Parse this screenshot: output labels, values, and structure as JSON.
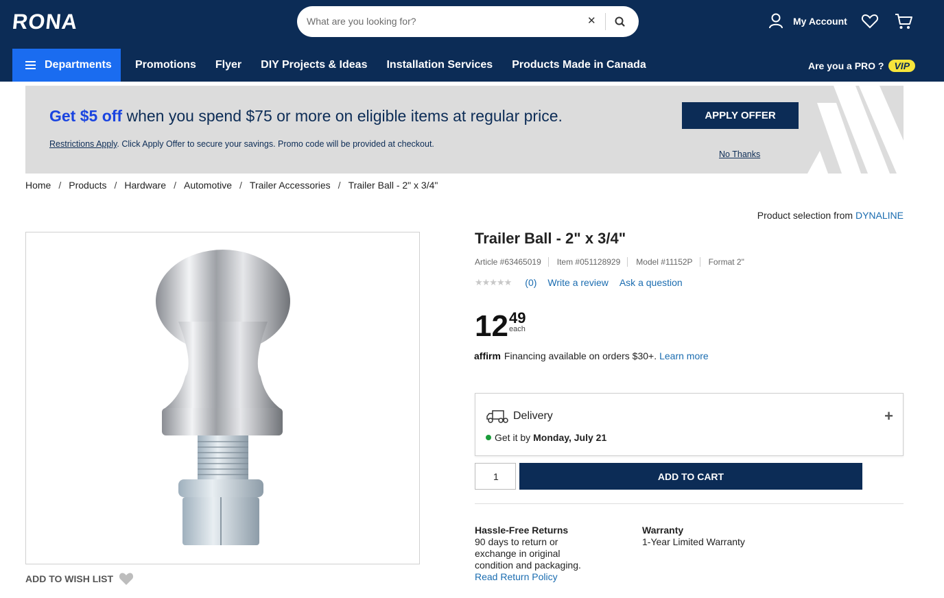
{
  "header": {
    "logo": "RONA",
    "search_placeholder": "What are you looking for?",
    "clear_symbol": "✕",
    "account_label": "My Account"
  },
  "nav": {
    "departments_label": "Departments",
    "links": [
      "Promotions",
      "Flyer",
      "DIY Projects & Ideas",
      "Installation Services",
      "Products Made in Canada"
    ],
    "pro_label": "Are you a PRO ?",
    "vip_label": "VIP"
  },
  "promo": {
    "highlight": "Get $5 off",
    "headline_rest": " when you spend $75 or more on eligible items at regular price.",
    "restrictions_link": "Restrictions Apply",
    "subtext": ". Click Apply Offer to secure your savings. Promo code will be provided at checkout.",
    "apply_label": "APPLY OFFER",
    "no_thanks_label": "No Thanks"
  },
  "breadcrumb": {
    "items": [
      "Home",
      "Products",
      "Hardware",
      "Automotive",
      "Trailer Accessories",
      "Trailer Ball - 2\" x 3/4\""
    ],
    "separator": "/"
  },
  "product": {
    "selection_prefix": "Product selection from ",
    "brand": "DYNALINE",
    "title": "Trailer Ball - 2\" x 3/4\"",
    "article": "Article #63465019",
    "item": "Item #051128929",
    "model": "Model #11152P",
    "format": "Format 2\"",
    "rating_stars": "★★★★★",
    "review_count": "(0)",
    "write_review_label": "Write a review",
    "ask_question_label": "Ask a question",
    "price_whole": "12",
    "price_cents": "49",
    "price_unit": "each",
    "affirm_logo": "affirm",
    "affirm_text": "Financing available on orders $30+.",
    "affirm_link": "Learn more",
    "wish_list_label": "ADD TO WISH LIST"
  },
  "delivery": {
    "title": "Delivery",
    "expand_symbol": "+",
    "eta_prefix": "Get it by",
    "eta_date": "Monday, July 21",
    "status_color": "#1a9c3a"
  },
  "cart": {
    "quantity": "1",
    "add_label": "ADD TO CART"
  },
  "returns": {
    "title": "Hassle-Free Returns",
    "text": "90 days to return or exchange in original condition and packaging.",
    "link": "Read Return Policy"
  },
  "warranty": {
    "title": "Warranty",
    "text": "1-Year Limited Warranty"
  },
  "colors": {
    "brand_navy": "#0c2c56",
    "accent_blue": "#1a6cf0",
    "link_blue": "#1a6cb0",
    "vip_yellow": "#f6e53b"
  }
}
